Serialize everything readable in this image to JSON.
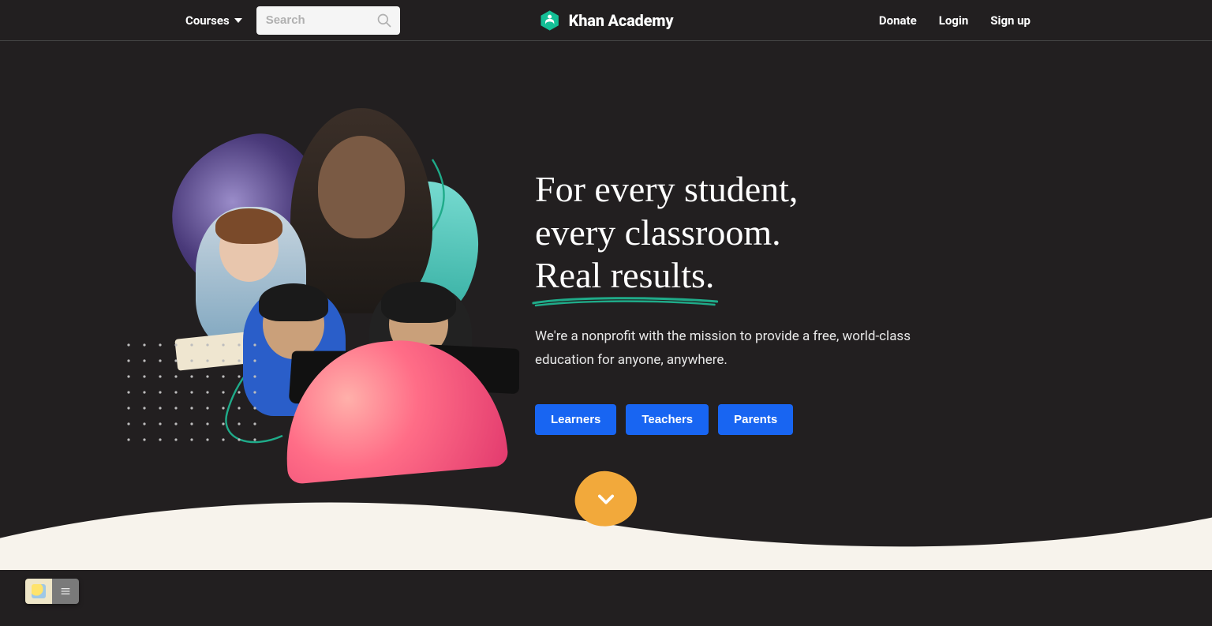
{
  "header": {
    "courses_label": "Courses",
    "search_placeholder": "Search",
    "brand": "Khan Academy",
    "links": {
      "donate": "Donate",
      "login": "Login",
      "signup": "Sign up"
    }
  },
  "hero": {
    "headline_line1": "For every student,",
    "headline_line2": "every classroom.",
    "headline_emphasis": "Real results.",
    "subhead": "We're a nonprofit with the mission to provide a free, world-class education for anyone, anywhere.",
    "cta": {
      "learners": "Learners",
      "teachers": "Teachers",
      "parents": "Parents"
    }
  },
  "colors": {
    "bg": "#221f20",
    "primary_blue": "#1865F2",
    "accent_green": "#1fab89",
    "scroll_badge": "#f2a93b"
  }
}
